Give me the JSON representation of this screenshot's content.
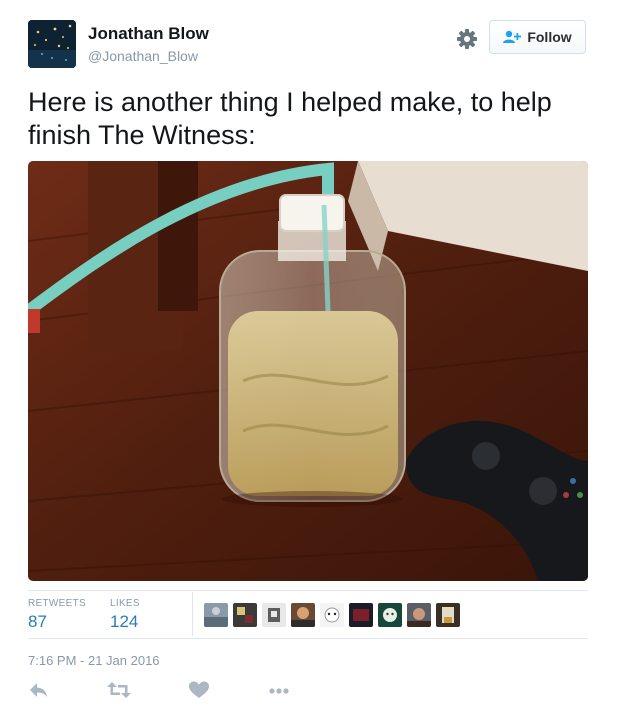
{
  "author": {
    "name": "Jonathan Blow",
    "handle": "@Jonathan_Blow"
  },
  "follow_button": {
    "label": "Follow",
    "icon": "add-user-icon"
  },
  "settings_icon": "gear-icon",
  "tweet": {
    "text": "Here is another thing I helped make, to help finish The Witness:"
  },
  "photo": {
    "subject": "plastic jug with tube on wooden table next to game controller"
  },
  "stats": {
    "retweets_label": "RETWEETS",
    "retweets_count": "87",
    "likes_label": "LIKES",
    "likes_count": "124",
    "liker_avatar_count": 9
  },
  "timestamp": "7:16 PM - 21 Jan 2016",
  "actions": [
    "reply-icon",
    "retweet-icon",
    "like-icon",
    "more-icon"
  ],
  "colors": {
    "link_blue": "#2b7bb9",
    "muted_gray": "#8899a6",
    "divider": "#e1e8ed"
  }
}
